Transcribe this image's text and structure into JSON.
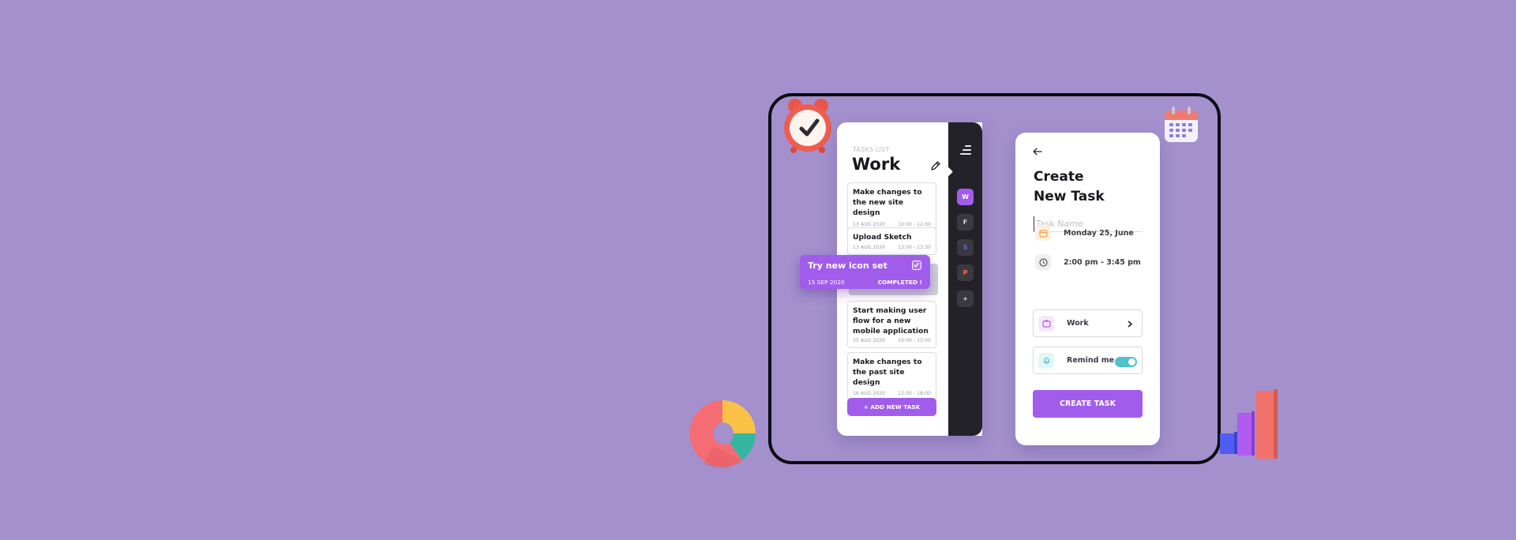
{
  "tasks_list": {
    "kicker": "TASKS LIST",
    "title": "Work",
    "tasks": [
      {
        "title": "Make changes to the new site design",
        "date": "13 AUG 2020",
        "time": "10:00 - 12:00"
      },
      {
        "title": "Upload Sketch",
        "date": "13 AUG 2020",
        "time": "13:00 - 13:30"
      },
      {
        "title": "Start making user flow for a new mobile application",
        "date": "15 AUG 2020",
        "time": "10:00 - 15:00"
      },
      {
        "title": "Make changes to the past site design",
        "date": "16 AUG 2020",
        "time": "12:00 - 18:00"
      }
    ],
    "add_button": "+ ADD NEW TASK"
  },
  "dragged_task": {
    "title": "Try new icon set",
    "date": "15 SEP 2020",
    "status": "COMPLETED !"
  },
  "sidebar": {
    "items": [
      {
        "letter": "W",
        "color": "#ffffff"
      },
      {
        "letter": "F",
        "color": "#d6d6da"
      },
      {
        "letter": "S",
        "color": "#4f6cf0"
      },
      {
        "letter": "P",
        "color": "#f26c4f"
      },
      {
        "letter": "+",
        "color": "#ffffff"
      }
    ]
  },
  "create_task": {
    "title_line1": "Create",
    "title_line2": "New Task",
    "name_placeholder": "Task Name",
    "date": "Monday 25, June",
    "time": "2:00 pm - 3:45 pm",
    "category": "Work",
    "remind_label": "Remind me",
    "remind_on": true,
    "create_button": "CREATE TASK"
  },
  "colors": {
    "accent": "#a25cec",
    "background": "#a390cd",
    "toggle": "#4cc3cd"
  }
}
